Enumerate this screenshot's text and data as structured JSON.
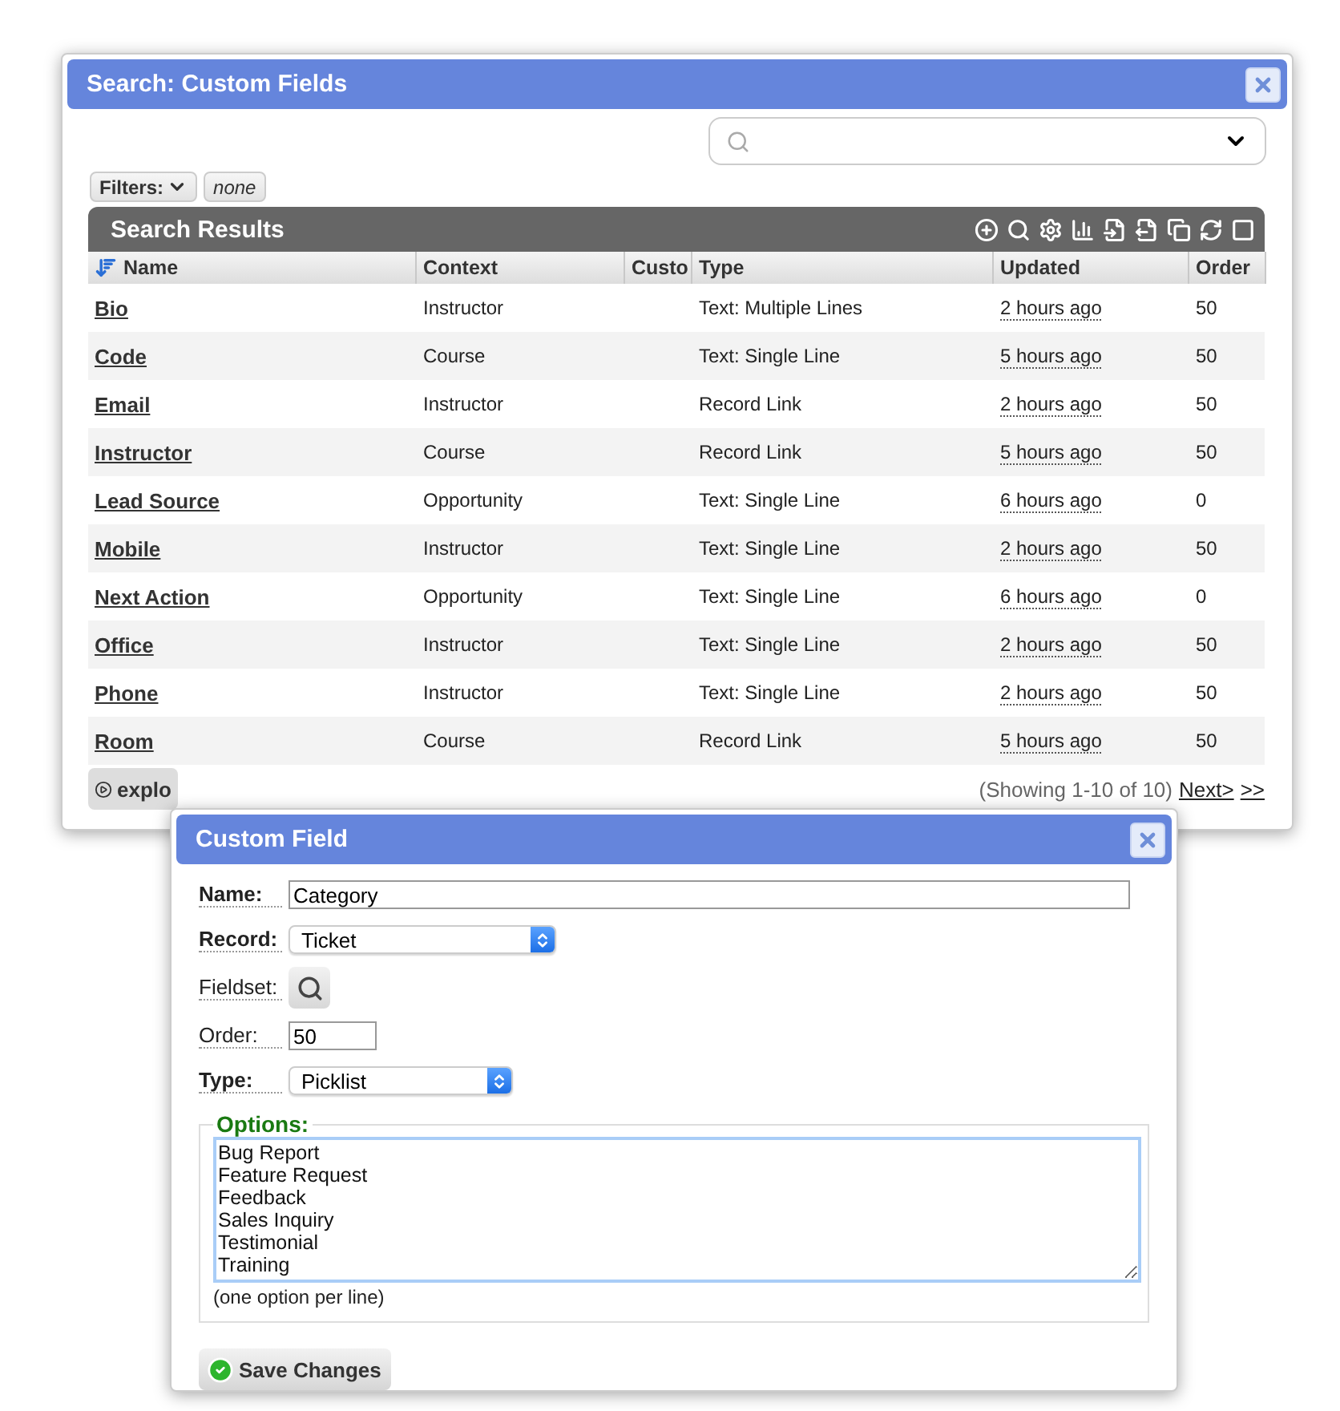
{
  "search_window": {
    "title": "Search: Custom Fields",
    "filters": {
      "label": "Filters:",
      "value": "none"
    },
    "results": {
      "title": "Search Results",
      "columns": [
        "Name",
        "Context",
        "Custo",
        "Type",
        "Updated",
        "Order"
      ],
      "rows": [
        {
          "name": "Bio",
          "context": "Instructor",
          "type": "Text: Multiple Lines",
          "updated": "2 hours ago",
          "order": "50"
        },
        {
          "name": "Code",
          "context": "Course",
          "type": "Text: Single Line",
          "updated": "5 hours ago",
          "order": "50"
        },
        {
          "name": "Email",
          "context": "Instructor",
          "type": "Record Link",
          "updated": "2 hours ago",
          "order": "50"
        },
        {
          "name": "Instructor",
          "context": "Course",
          "type": "Record Link",
          "updated": "5 hours ago",
          "order": "50"
        },
        {
          "name": "Lead Source",
          "context": "Opportunity",
          "type": "Text: Single Line",
          "updated": "6 hours ago",
          "order": "0"
        },
        {
          "name": "Mobile",
          "context": "Instructor",
          "type": "Text: Single Line",
          "updated": "2 hours ago",
          "order": "50"
        },
        {
          "name": "Next Action",
          "context": "Opportunity",
          "type": "Text: Single Line",
          "updated": "6 hours ago",
          "order": "0"
        },
        {
          "name": "Office",
          "context": "Instructor",
          "type": "Text: Single Line",
          "updated": "2 hours ago",
          "order": "50"
        },
        {
          "name": "Phone",
          "context": "Instructor",
          "type": "Text: Single Line",
          "updated": "2 hours ago",
          "order": "50"
        },
        {
          "name": "Room",
          "context": "Course",
          "type": "Record Link",
          "updated": "5 hours ago",
          "order": "50"
        }
      ]
    },
    "explore_button": "explo",
    "showing": "(Showing 1-10 of 10)",
    "next_link": "Next>",
    "last_link": ">>"
  },
  "dialog": {
    "title": "Custom Field",
    "fields": [
      {
        "kind": "text",
        "label": "Name:",
        "bold": true,
        "value": "Category"
      },
      {
        "kind": "select",
        "label": "Record:",
        "bold": true,
        "value": "Ticket"
      },
      {
        "kind": "lookup",
        "label": "Fieldset:",
        "bold": false
      },
      {
        "kind": "number",
        "label": "Order:",
        "bold": false,
        "value": "50"
      },
      {
        "kind": "select",
        "label": "Type:",
        "bold": true,
        "value": "Picklist"
      }
    ],
    "options": {
      "legend": "Options:",
      "lines": [
        "Bug Report",
        "Feature Request",
        "Feedback",
        "Sales Inquiry",
        "Testimonial",
        "Training"
      ],
      "hint": "(one option per line)"
    },
    "save_button": "Save Changes"
  }
}
